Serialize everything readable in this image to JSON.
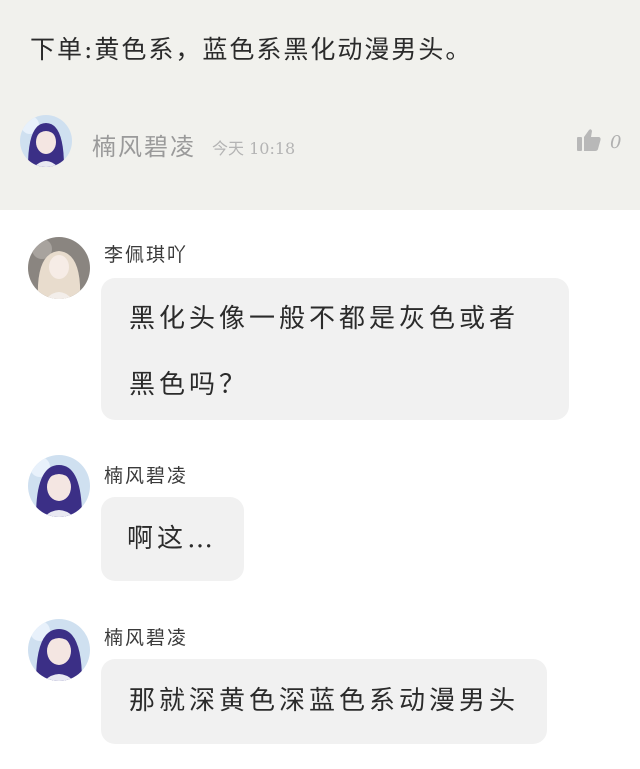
{
  "post": {
    "text": "下单:黄色系，蓝色系黑化动漫男头。",
    "author": "楠风碧凌",
    "time": "今天 10:18",
    "likes": "0",
    "icons": {
      "like": "thumbs-up-icon"
    }
  },
  "comments": [
    {
      "name": "李佩琪吖",
      "text": "黑化头像一般不都是灰色或者黑色吗？"
    },
    {
      "name": "楠风碧凌",
      "text": "啊这…"
    },
    {
      "name": "楠风碧凌",
      "text": "那就深黄色深蓝色系动漫男头"
    }
  ],
  "colors": {
    "header_background": "#f1f1ed",
    "bubble_background": "#f1f1f1",
    "muted_text": "#9a9a9a"
  }
}
